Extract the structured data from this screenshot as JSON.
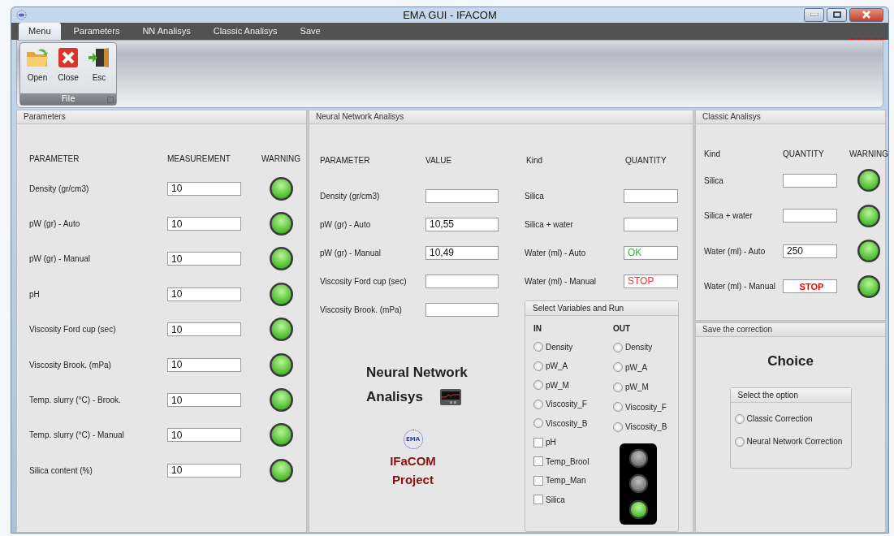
{
  "window": {
    "title": "EMA GUI - IFACOM"
  },
  "menu_tabs": [
    {
      "label": "Menu",
      "selected": true
    },
    {
      "label": "Parameters",
      "selected": false
    },
    {
      "label": "NN Analisys",
      "selected": false
    },
    {
      "label": "Classic Analisys",
      "selected": false
    },
    {
      "label": "Save",
      "selected": false
    }
  ],
  "ribbon": {
    "group": "File",
    "buttons": [
      {
        "kind": "open",
        "label": "Open"
      },
      {
        "kind": "close",
        "label": "Close"
      },
      {
        "kind": "exit",
        "label": "Esc"
      }
    ]
  },
  "parameters_panel": {
    "title": "Parameters",
    "columns": [
      "PARAMETER",
      "MEASUREMENT",
      "WARNING"
    ],
    "rows": [
      {
        "name": "Density  (gr/cm3)",
        "value": "10",
        "lit": true
      },
      {
        "name": "pW (gr)  - Auto",
        "value": "10",
        "lit": true
      },
      {
        "name": "pW (gr)  - Manual",
        "value": "10",
        "lit": true
      },
      {
        "name": "pH",
        "value": "10",
        "lit": true
      },
      {
        "name": "Viscosity Ford cup (sec)",
        "value": "10",
        "lit": true
      },
      {
        "name": "Viscosity Brook. (mPa)",
        "value": "10",
        "lit": true
      },
      {
        "name": "Temp. slurry (°C) - Brook.",
        "value": "10",
        "lit": true
      },
      {
        "name": "Temp. slurry (°C) - Manual",
        "value": "10",
        "lit": true
      },
      {
        "name": "Silica content (%)",
        "value": "10",
        "lit": true
      }
    ]
  },
  "nn_panel": {
    "title": "Neural Network Analisys",
    "columns": [
      "PARAMETER",
      "VALUE",
      "Kind",
      "QUANTITY"
    ],
    "parameters": [
      {
        "name": "Density  (gr/cm3)"
      },
      {
        "name": "pW (gr) - Auto",
        "value": "10,55"
      },
      {
        "name": "pW (gr) - Manual",
        "value": "10,49"
      },
      {
        "name": "Viscosity Ford cup (sec)"
      },
      {
        "name": "Viscosity Brook. (mPa)"
      }
    ],
    "quantities": [
      {
        "name": "Silica",
        "kind": "plain"
      },
      {
        "name": "Silica + water",
        "kind": "plain"
      },
      {
        "name": "Water (ml) - Auto",
        "value": "OK",
        "kind": "ok"
      },
      {
        "name": "Water (ml)  - Manual",
        "value": "STOP",
        "kind": "stop"
      }
    ],
    "heading_line1": "Neural Network",
    "heading_line2": "Analisys",
    "logo_text": "EMA",
    "project_line1": "IFaCOM",
    "project_line2": "Project",
    "select_box": {
      "title": "Select Variables and Run",
      "in_label": "IN",
      "out_label": "OUT",
      "inputs": [
        {
          "kind": "radio",
          "label": "Density",
          "selected": false
        },
        {
          "kind": "radio",
          "label": "pW_A",
          "selected": false
        },
        {
          "kind": "radio",
          "label": "pW_M",
          "selected": false
        },
        {
          "kind": "radio",
          "label": "Viscosity_F",
          "selected": false
        },
        {
          "kind": "radio",
          "label": "Viscosity_B",
          "selected": false
        },
        {
          "kind": "checkbox",
          "label": "pH",
          "checked": false
        },
        {
          "kind": "checkbox",
          "label": "Temp_Brool",
          "checked": false
        },
        {
          "kind": "checkbox",
          "label": "Temp_Man",
          "checked": false
        },
        {
          "kind": "checkbox",
          "label": "Silica",
          "checked": false
        }
      ],
      "outputs": [
        {
          "label": "Density",
          "selected": false
        },
        {
          "label": "pW_A",
          "selected": false
        },
        {
          "label": "pW_M",
          "selected": false
        },
        {
          "label": "Viscosity_F",
          "selected": false
        },
        {
          "label": "Viscosity_B",
          "selected": false
        }
      ],
      "traffic_light": [
        {
          "lit": false
        },
        {
          "lit": false
        },
        {
          "lit": true
        }
      ]
    }
  },
  "classic_panel": {
    "title": "Classic Analisys",
    "columns": [
      "Kind",
      "QUANTITY",
      "WARNING"
    ],
    "rows": [
      {
        "name": "Silica",
        "kind": "plain",
        "lit": true
      },
      {
        "name": "Silica + water",
        "kind": "plain",
        "lit": true
      },
      {
        "name": "Water (ml) - Auto",
        "value": "250",
        "kind": "plain",
        "lit": true
      },
      {
        "name": "Water (ml) - Manual",
        "value": "STOP",
        "kind": "alarm",
        "lit": true
      }
    ]
  },
  "save_panel": {
    "title": "Save the correction",
    "heading": "Choice",
    "group_title": "Select the option",
    "options": [
      {
        "label": "Classic Correction",
        "selected": false
      },
      {
        "label": "Neural Network Correction",
        "selected": false
      }
    ]
  }
}
